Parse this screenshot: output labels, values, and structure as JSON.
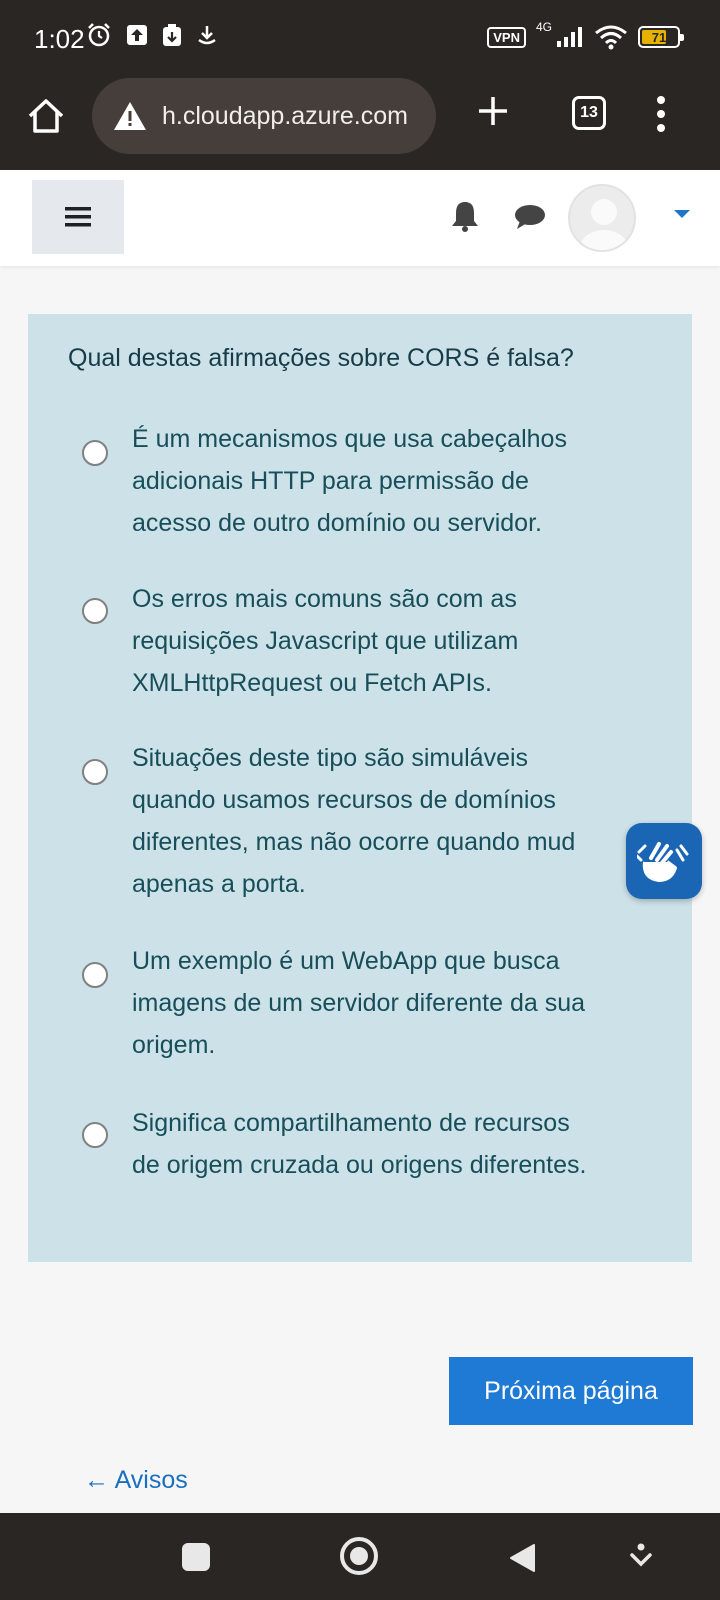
{
  "status_bar": {
    "time": "1:02",
    "vpn_label": "VPN",
    "network_label": "4G",
    "battery_level": "71"
  },
  "browser": {
    "url": "h.cloudapp.azure.com",
    "tab_count": "13"
  },
  "quiz": {
    "question": "Qual destas afirmações sobre CORS é falsa?",
    "options": [
      {
        "label": "É um mecanismos que usa cabeçalhos\nadicionais HTTP para permissão de\nacesso de outro domínio ou servidor."
      },
      {
        "label": "Os erros  mais comuns são com as\nrequisições Javascript que utilizam\nXMLHttpRequest ou Fetch APIs."
      },
      {
        "label": "Situações deste tipo são simuláveis\nquando usamos recursos de domínios\ndiferentes, mas não ocorre quando mud\napenas a porta."
      },
      {
        "label": "Um exemplo é um WebApp que busca\nimagens de um servidor diferente da sua\norigem."
      },
      {
        "label": "Significa compartilhamento de recursos\nde origem cruzada ou origens diferentes."
      }
    ]
  },
  "navigation": {
    "next_page": "Próxima página",
    "previous_link": "← Avisos"
  },
  "colors": {
    "card_background": "#cce2e8",
    "primary_button": "#1f7ad5",
    "system_bars": "#2a2624",
    "accessibility_button": "#1a66b5"
  },
  "icons": {
    "status_left": [
      "alarm-icon",
      "upload-icon",
      "download-manager-icon",
      "download-icon"
    ],
    "header": [
      "menu-icon",
      "bell-icon",
      "chat-icon",
      "avatar",
      "caret-down-icon"
    ],
    "accessibility": "sign-language-hands-icon"
  }
}
